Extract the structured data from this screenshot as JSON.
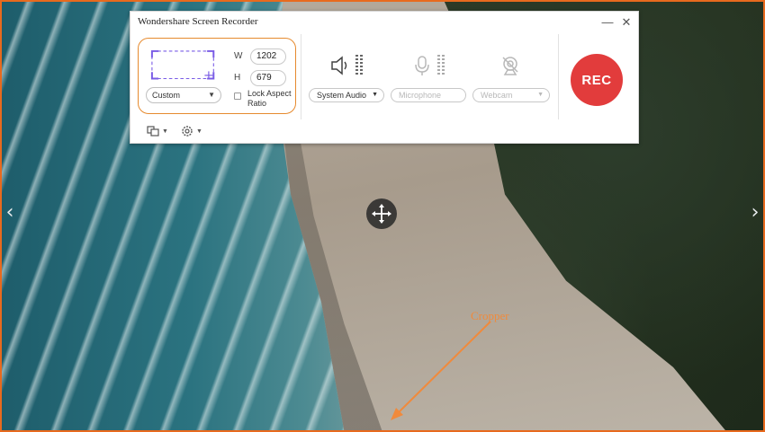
{
  "window": {
    "title": "Wondershare Screen Recorder"
  },
  "area": {
    "mode": "Custom",
    "width_label": "W",
    "width_value": "1202",
    "height_label": "H",
    "height_value": "679",
    "lock_aspect_label": "Lock Aspect Ratio"
  },
  "devices": {
    "system_audio": {
      "label": "System Audio",
      "icon": "speaker-icon",
      "enabled": true
    },
    "microphone": {
      "label": "Microphone",
      "icon": "microphone-icon",
      "enabled": false
    },
    "webcam": {
      "label": "Webcam",
      "icon": "webcam-icon",
      "enabled": false
    }
  },
  "record_button": {
    "label": "REC",
    "color": "#e23c3c"
  },
  "toolbar": {
    "screenshot_icon": "screenshot-icon",
    "settings_icon": "settings-icon"
  },
  "annotation": {
    "label": "Cropper",
    "color": "#f08a3c"
  },
  "colors": {
    "accent_orange": "#e86a1e",
    "selection_purple": "#7a5ce6"
  }
}
